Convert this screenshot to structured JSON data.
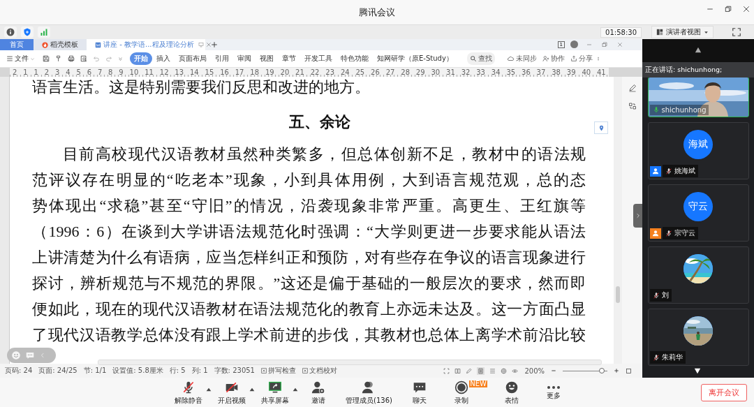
{
  "window": {
    "title": "腾讯会议"
  },
  "meeting_bar": {
    "timer": "01:58:30",
    "view_button": "演讲者视图"
  },
  "shared_screen": {
    "tabs": [
      {
        "label": "首页",
        "kind": "home",
        "selected": false
      },
      {
        "label": "稻壳模板",
        "kind": "template",
        "selected": false
      },
      {
        "label": "讲座 - 教学语...程及理论分析",
        "kind": "doc",
        "selected": true
      }
    ],
    "page_badge": "1",
    "menu": "文件",
    "ribbon_tabs": [
      {
        "label": "开始",
        "selected": true
      },
      {
        "label": "插入",
        "selected": false
      },
      {
        "label": "页面布局",
        "selected": false
      },
      {
        "label": "引用",
        "selected": false
      },
      {
        "label": "审阅",
        "selected": false
      },
      {
        "label": "视图",
        "selected": false
      },
      {
        "label": "章节",
        "selected": false
      },
      {
        "label": "开发工具",
        "selected": false
      },
      {
        "label": "特色功能",
        "selected": false
      },
      {
        "label": "知网研学（原E-Study）",
        "selected": false
      }
    ],
    "ribbon_actions": [
      {
        "label": "查找",
        "kind": "search"
      },
      {
        "label": "未同步",
        "kind": "cloud"
      },
      {
        "label": "协作",
        "kind": "collab"
      },
      {
        "label": "分享",
        "kind": "share"
      }
    ],
    "ruler_labels": [
      "2",
      "1",
      "1",
      "2",
      "3",
      "4",
      "5",
      "6",
      "7",
      "8",
      "9",
      "10",
      "11",
      "12",
      "13",
      "14",
      "15",
      "16",
      "17",
      "18",
      "19",
      "20",
      "21",
      "22",
      "23",
      "24",
      "25",
      "26",
      "27",
      "28",
      "29",
      "30",
      "31",
      "32",
      "33",
      "34",
      "35",
      "36",
      "37",
      "38",
      "39",
      "40",
      "41"
    ],
    "document": {
      "top_line": "语言生活。这是特别需要我们反思和改进的地方。",
      "heading": "五、余论",
      "paragraph": [
        "目前高校现代汉语教材虽然种类繁多，但总体创新不足，教材中的语法规",
        "范评议存在明显的“吃老本”现象，小到具体用例，大到语言规范观，总的态",
        "势体现出“求稳”甚至“守旧”的情况，沿袭现象非常严重。高更生、王红旗等",
        "（1996：6）在谈到大学讲语法规范化时强调：“大学则更进一步要求能从语法",
        "上讲清楚为什么有语病，应当怎样纠正和预防，对有些存在争议的语言现象进行",
        "探讨，辨析规范与不规范的界限。”这还是偏于基础的一般层次的要求，然而即",
        "便如此，现在的现代汉语教材在语法规范化的教育上亦远未达及。这一方面凸显",
        "了现代汉语教学总体没有跟上学术前进的步伐，其教材也总体上离学术前沿比较"
      ]
    },
    "status_bar": {
      "items": [
        "页码: 24",
        "页面: 24/25",
        "节: 1/1",
        "设置值: 5.8厘米",
        "行: 5",
        "列: 1",
        "字数: 23051"
      ],
      "checks": [
        "拼写检查",
        "文档校对"
      ],
      "zoom": "200%",
      "zoom_slider": {
        "level": 0.88
      }
    }
  },
  "speaking": "正在讲话: shichunhong;",
  "participants": [
    {
      "name": "shichunhong",
      "kind": "video",
      "muted": false,
      "speaking": true
    },
    {
      "name": "姚海斌",
      "kind": "initials",
      "initials": "海斌",
      "muted": true,
      "speaking": false,
      "color": "#1677ff"
    },
    {
      "name": "宗守云",
      "kind": "initials",
      "initials": "守云",
      "muted": true,
      "speaking": false,
      "color": "#f7811e"
    },
    {
      "name": "刘",
      "muted": true,
      "speaking": false
    },
    {
      "name": "朱莉华",
      "muted": true,
      "speaking": false
    }
  ],
  "toolbar": [
    {
      "label": "解除静音",
      "kind": "mic",
      "has_menu": true
    },
    {
      "label": "开启视频",
      "kind": "camera",
      "has_menu": true
    },
    {
      "label": "共享屏幕",
      "kind": "share",
      "has_menu": true
    },
    {
      "label": "邀请",
      "kind": "invite",
      "has_menu": false
    },
    {
      "label": "管理成员(136)",
      "kind": "members",
      "has_menu": false
    },
    {
      "label": "聊天",
      "kind": "chat",
      "has_menu": false
    },
    {
      "label": "录制",
      "kind": "record",
      "has_menu": false,
      "badge": "NEW"
    },
    {
      "label": "表情",
      "kind": "emoji",
      "has_menu": false
    },
    {
      "label": "更多",
      "kind": "more",
      "has_menu": false
    }
  ],
  "leave_button": "离开会议"
}
